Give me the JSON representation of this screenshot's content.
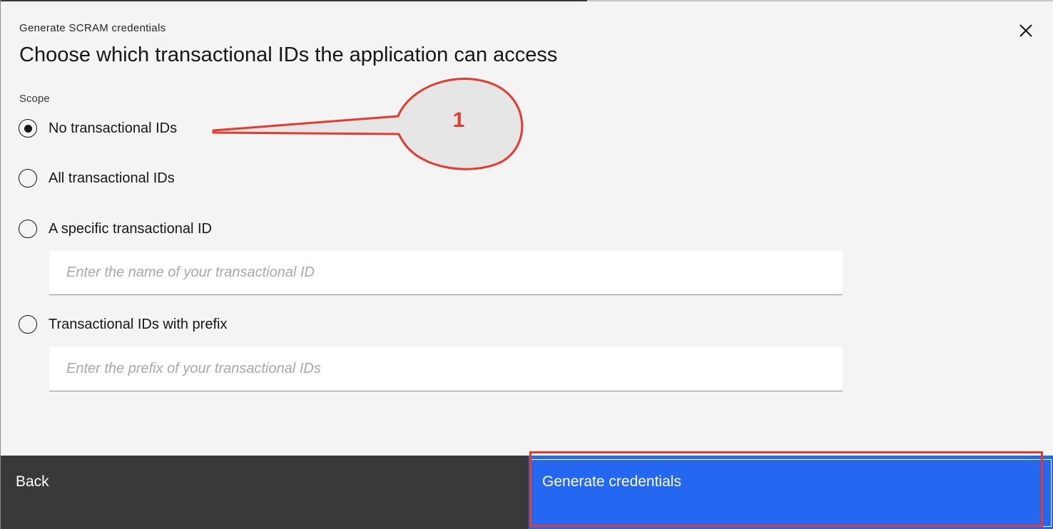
{
  "modal": {
    "eyebrow": "Generate SCRAM credentials",
    "title": "Choose which transactional IDs the application can access",
    "close_icon": "close-icon"
  },
  "scope": {
    "legend": "Scope",
    "selected": "No transactional IDs",
    "options": [
      {
        "label": "No transactional IDs",
        "checked": true
      },
      {
        "label": "All transactional IDs",
        "checked": false
      },
      {
        "label": "A specific transactional ID",
        "checked": false
      },
      {
        "label": "Transactional IDs with prefix",
        "checked": false
      }
    ],
    "specific_input": {
      "value": "",
      "placeholder": "Enter the name of your transactional ID"
    },
    "prefix_input": {
      "value": "",
      "placeholder": "Enter the prefix of your transactional IDs"
    }
  },
  "footer": {
    "back_label": "Back",
    "generate_label": "Generate credentials"
  },
  "annotation": {
    "callout_number": "1",
    "color": "#e53a2e"
  },
  "colors": {
    "primary": "#2468f2",
    "secondary": "#393939",
    "background": "#f4f4f4"
  }
}
